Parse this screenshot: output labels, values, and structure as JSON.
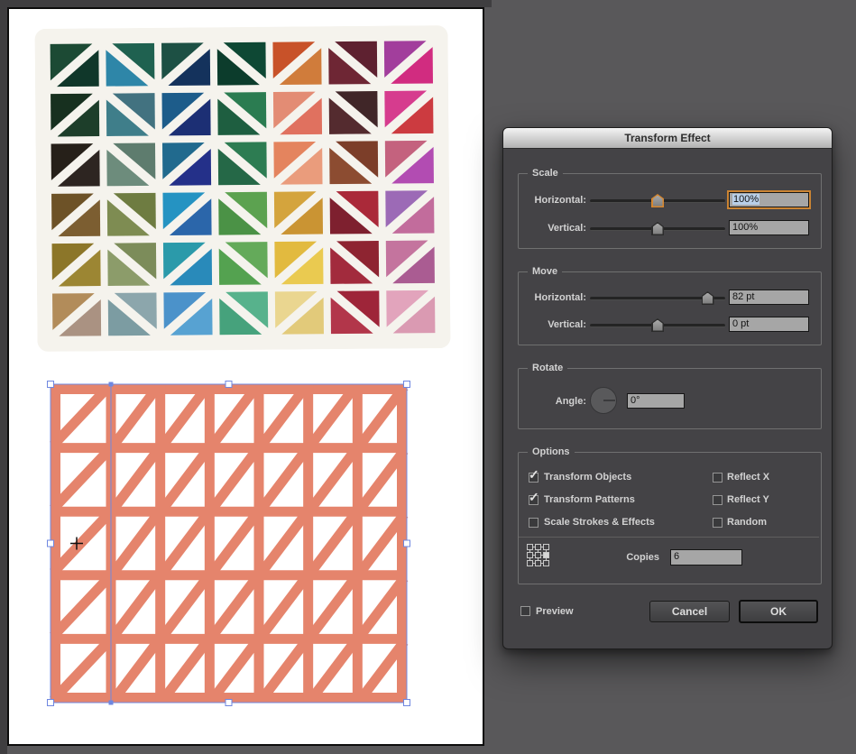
{
  "window": {
    "background": "#59585a",
    "canvas_color": "#ffffff"
  },
  "dialog": {
    "title": "Transform Effect",
    "accent_orange": "#cb8433",
    "text_selection_blue": "#b9cfe8",
    "groups": {
      "scale": {
        "label": "Scale",
        "rows": [
          {
            "label": "Horizontal:",
            "value": "100%",
            "slider_pos": 0.5,
            "focused": true
          },
          {
            "label": "Vertical:",
            "value": "100%",
            "slider_pos": 0.5,
            "focused": false
          }
        ]
      },
      "move": {
        "label": "Move",
        "rows": [
          {
            "label": "Horizontal:",
            "value": "82 pt",
            "slider_pos": 0.87,
            "focused": false
          },
          {
            "label": "Vertical:",
            "value": "0 pt",
            "slider_pos": 0.5,
            "focused": false
          }
        ]
      },
      "rotate": {
        "label": "Rotate",
        "angle_label": "Angle:",
        "value": "0°",
        "angle_deg": 0
      },
      "options": {
        "label": "Options",
        "left": [
          {
            "label": "Transform Objects",
            "checked": true
          },
          {
            "label": "Transform Patterns",
            "checked": true
          },
          {
            "label": "Scale Strokes & Effects",
            "checked": false
          }
        ],
        "right": [
          {
            "label": "Reflect X",
            "checked": false
          },
          {
            "label": "Reflect Y",
            "checked": false
          },
          {
            "label": "Random",
            "checked": false
          }
        ],
        "reference_point": "middle-right",
        "copies_label": "Copies",
        "copies_value": "6"
      }
    },
    "preview_label": "Preview",
    "buttons": {
      "cancel": "Cancel",
      "ok": "OK"
    }
  },
  "artwork": {
    "quilt": {
      "sashing_color": "#f5f3ed",
      "rows": [
        [
          [
            "/",
            "#1c4a34",
            "#10372a"
          ],
          [
            "\\",
            "#1f6150",
            "#2e86a8"
          ],
          [
            "/",
            "#1d5044",
            "#14325c"
          ],
          [
            "\\",
            "#0e4834",
            "#0c3c2c"
          ],
          [
            "/",
            "#c85229",
            "#d07c3b"
          ],
          [
            "\\",
            "#5e2130",
            "#6e2634"
          ],
          [
            "/",
            "#a23e9c",
            "#d12c80"
          ]
        ],
        [
          [
            "/",
            "#17301f",
            "#1d3e2a"
          ],
          [
            "\\",
            "#427280",
            "#3f7e8a"
          ],
          [
            "/",
            "#1d5c8a",
            "#1c2f74"
          ],
          [
            "\\",
            "#2b7c51",
            "#1e5e40"
          ],
          [
            "/",
            "#e38c74",
            "#e0715f"
          ],
          [
            "\\",
            "#402628",
            "#542b2f"
          ],
          [
            "/",
            "#d63c8e",
            "#cc3b40"
          ]
        ],
        [
          [
            "/",
            "#262019",
            "#2d2521"
          ],
          [
            "\\",
            "#5e7c6e",
            "#6d8c7c"
          ],
          [
            "/",
            "#216a8e",
            "#243089"
          ],
          [
            "\\",
            "#2d7c52",
            "#256847"
          ],
          [
            "/",
            "#e4845e",
            "#ea9c7c"
          ],
          [
            "\\",
            "#7c3e29",
            "#8c4c31"
          ],
          [
            "/",
            "#c4627e",
            "#b24cb2"
          ]
        ],
        [
          [
            "/",
            "#6d5227",
            "#7c5e31"
          ],
          [
            "\\",
            "#6e7c41",
            "#7e8c52"
          ],
          [
            "/",
            "#2593c2",
            "#2b66aa"
          ],
          [
            "\\",
            "#5ca250",
            "#4b9246"
          ],
          [
            "/",
            "#d4a43d",
            "#ca9433"
          ],
          [
            "\\",
            "#aa2939",
            "#7e202f"
          ],
          [
            "/",
            "#9c6ab6",
            "#c26c9c"
          ]
        ],
        [
          [
            "/",
            "#8c7629",
            "#9c8633"
          ],
          [
            "\\",
            "#7c8c5a",
            "#8c9c6a"
          ],
          [
            "/",
            "#2b9aaa",
            "#298aba"
          ],
          [
            "\\",
            "#64aa5a",
            "#54a250"
          ],
          [
            "/",
            "#e2ba3f",
            "#eaca50"
          ],
          [
            "\\",
            "#8e2431",
            "#a22b3d"
          ],
          [
            "/",
            "#c4749e",
            "#aa5c92"
          ]
        ],
        [
          [
            "/",
            "#b28c5a",
            "#aa9282"
          ],
          [
            "\\",
            "#8ca6ac",
            "#7c9ca2"
          ],
          [
            "/",
            "#4b92ca",
            "#57a2d2"
          ],
          [
            "\\",
            "#57b28c",
            "#46a27c"
          ],
          [
            "/",
            "#ead690",
            "#e2ca7a"
          ],
          [
            "\\",
            "#9e2539",
            "#b2364a"
          ],
          [
            "/",
            "#e2a4bc",
            "#da9ab2"
          ]
        ]
      ]
    },
    "pattern": {
      "color": "#e5846c",
      "stroke": 11,
      "cols": 7,
      "rows": 5,
      "diagonal": "/"
    },
    "selection": {
      "outline_color": "#6f87e0",
      "handle_fill": "#ffffff",
      "cursor": "crosshair"
    }
  }
}
